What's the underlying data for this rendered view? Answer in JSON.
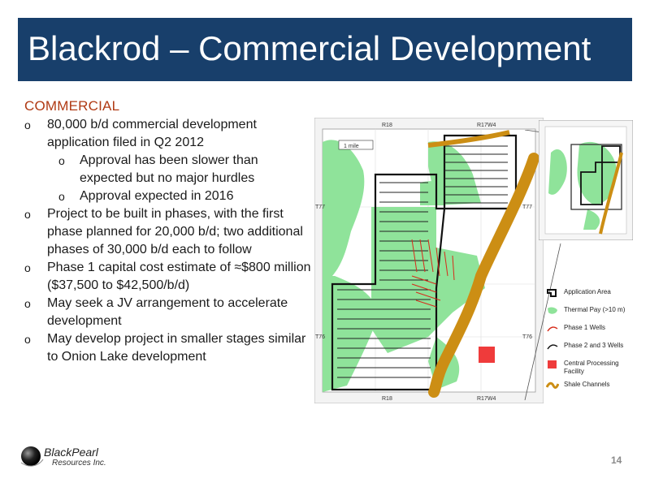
{
  "slide": {
    "title": "Blackrod – Commercial Development",
    "section_heading": "COMMERCIAL",
    "bullet_marker": "o",
    "bullets": [
      {
        "text": "80,000 b/d commercial development application filed in Q2 2012",
        "level": 1
      },
      {
        "text": "Approval has been slower than expected but no major hurdles",
        "level": 2
      },
      {
        "text": "Approval expected in 2016",
        "level": 2
      },
      {
        "text": "Project to be built in phases, with the first phase planned for 20,000 b/d; two additional phases of 30,000 b/d each to follow",
        "level": 1
      },
      {
        "text": "Phase 1 capital cost estimate of ≈$800 million ($37,500 to $42,500/b/d)",
        "level": 1
      },
      {
        "text": "May seek a JV arrangement to accelerate development",
        "level": 1
      },
      {
        "text": "May develop project in smaller stages similar to Onion Lake development",
        "level": 1
      }
    ],
    "page_number": "14"
  },
  "map": {
    "range_labels": {
      "top_left": "R18",
      "top_right": "R17W4",
      "bottom_left": "R18",
      "bottom_right": "R17W4"
    },
    "township_labels": {
      "upper_left": "T77",
      "upper_right": "T77",
      "lower_left": "T76",
      "lower_right": "T76"
    },
    "scale_label": "1 mile"
  },
  "legend": {
    "items": [
      {
        "label": "Application Area"
      },
      {
        "label": "Thermal Pay (>10 m)"
      },
      {
        "label": "Phase 1 Wells"
      },
      {
        "label": "Phase 2 and 3 Wells"
      },
      {
        "label": "Central Processing Facility"
      },
      {
        "label": "Shale Channels"
      }
    ]
  },
  "logo": {
    "name_line1": "BlackPearl",
    "name_line2": "Resources Inc."
  },
  "colors": {
    "title_bar": "#183f6b",
    "heading": "#b03a14",
    "thermal_pay": "#8fe39a",
    "shale": "#cc8e14",
    "cpf": "#ef3b3b",
    "phase1": "#d62b1a"
  }
}
